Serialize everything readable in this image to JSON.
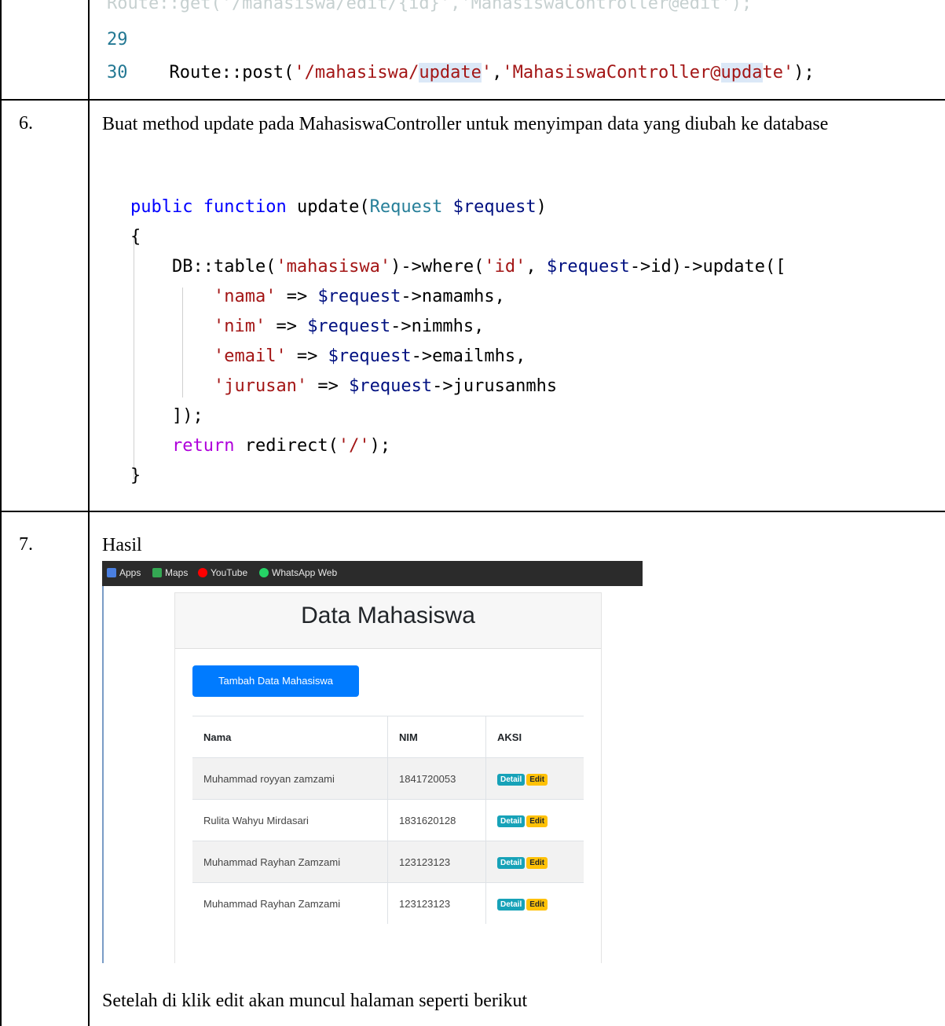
{
  "rows": [
    {
      "code_lines": [
        {
          "num": "29"
        },
        {
          "num": "30",
          "prefix": "Route::post(",
          "s1": "'/mahasiswa/",
          "s1hl": "update",
          "s2": "'",
          "comma": ",",
          "s3": "'MahasiswaController@",
          "s3hl": "upda",
          "s3b": "te'",
          "suffix": ");"
        }
      ]
    },
    {
      "num": "6.",
      "text": "Buat method update pada MahasiswaController untuk menyimpan data yang diubah ke database",
      "code": [
        "public function update(Request $request)",
        "{",
        "    DB::table('mahasiswa')->where('id', $request->id)->update([",
        "        'nama' => $request->namamhs,",
        "        'nim' => $request->nimmhs,",
        "        'email' => $request->emailmhs,",
        "        'jurusan' => $request->jurusanmhs",
        "    ]);",
        "    return redirect('/');",
        "}"
      ]
    },
    {
      "num": "7.",
      "text": "Hasil",
      "footer": "Setelah di klik edit akan muncul halaman seperti berikut",
      "browser": {
        "bookmarks": [
          "Apps",
          "Maps",
          "YouTube",
          "WhatsApp Web"
        ],
        "title": "Data Mahasiswa",
        "add_button": "Tambah Data Mahasiswa",
        "headers": [
          "Nama",
          "NIM",
          "AKSI"
        ],
        "table": [
          [
            "Muhammad royyan zamzami",
            "1841720053"
          ],
          [
            "Rulita Wahyu Mirdasari",
            "1831620128"
          ],
          [
            "Muhammad Rayhan Zamzami",
            "123123123"
          ],
          [
            "Muhammad Rayhan Zamzami",
            "123123123"
          ]
        ],
        "detail_label": "Detail",
        "edit_label": "Edit"
      }
    }
  ]
}
